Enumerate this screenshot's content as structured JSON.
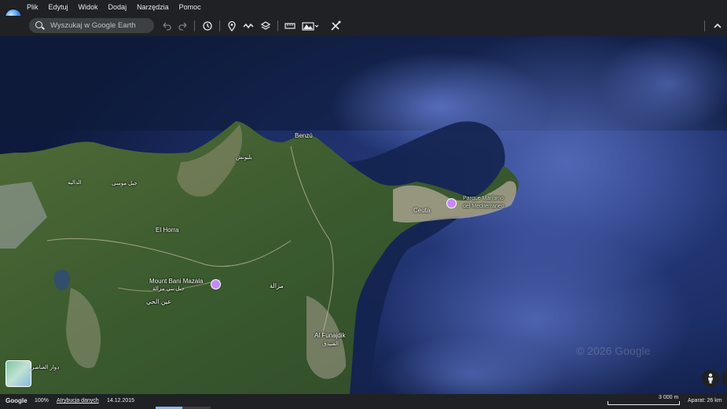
{
  "menu": {
    "items": [
      "Plik",
      "Edytuj",
      "Widok",
      "Dodaj",
      "Narzędzia",
      "Pomoc"
    ]
  },
  "toolbar": {
    "search_placeholder": "Wyszukaj w Google Earth",
    "icons": [
      "undo-icon",
      "redo-icon",
      "history-icon",
      "placemark-icon",
      "path-icon",
      "layers-icon",
      "ruler-icon",
      "capture-icon",
      "measure-icon"
    ]
  },
  "map": {
    "labels": {
      "benzu": "Benzú",
      "ceuta": "Ceuta",
      "parque_line1": "Parque Marítimo",
      "parque_line2": "del Mediterráneo",
      "el_horra": "El Horra",
      "mount_bani": "Mount Bani Mazala",
      "mount_bani_ar": "جبل بني مزالة",
      "ain_hayy": "عين الحي",
      "mzala": "مزالة",
      "al_funajdiq": "Al Funajdik",
      "al_funajdiq_ar": "الفنيدق",
      "dalia": "الداليه",
      "belyounech": "بليونش",
      "douar": "دوار العناصر",
      "small1": "جبل موسى"
    },
    "watermark": "© 2026 Google",
    "colors": {
      "sea_deep": "#1d2f64",
      "sea_shallow": "#3d5dbb",
      "land": "#3f5a2e",
      "poi": "#c58af9"
    }
  },
  "status": {
    "brand": "Google",
    "zoom": "100%",
    "attribution": "Atrybucja danych",
    "date": "14.12.2015",
    "scale": "3 000 m",
    "camera": "Aparat: 26 km"
  }
}
